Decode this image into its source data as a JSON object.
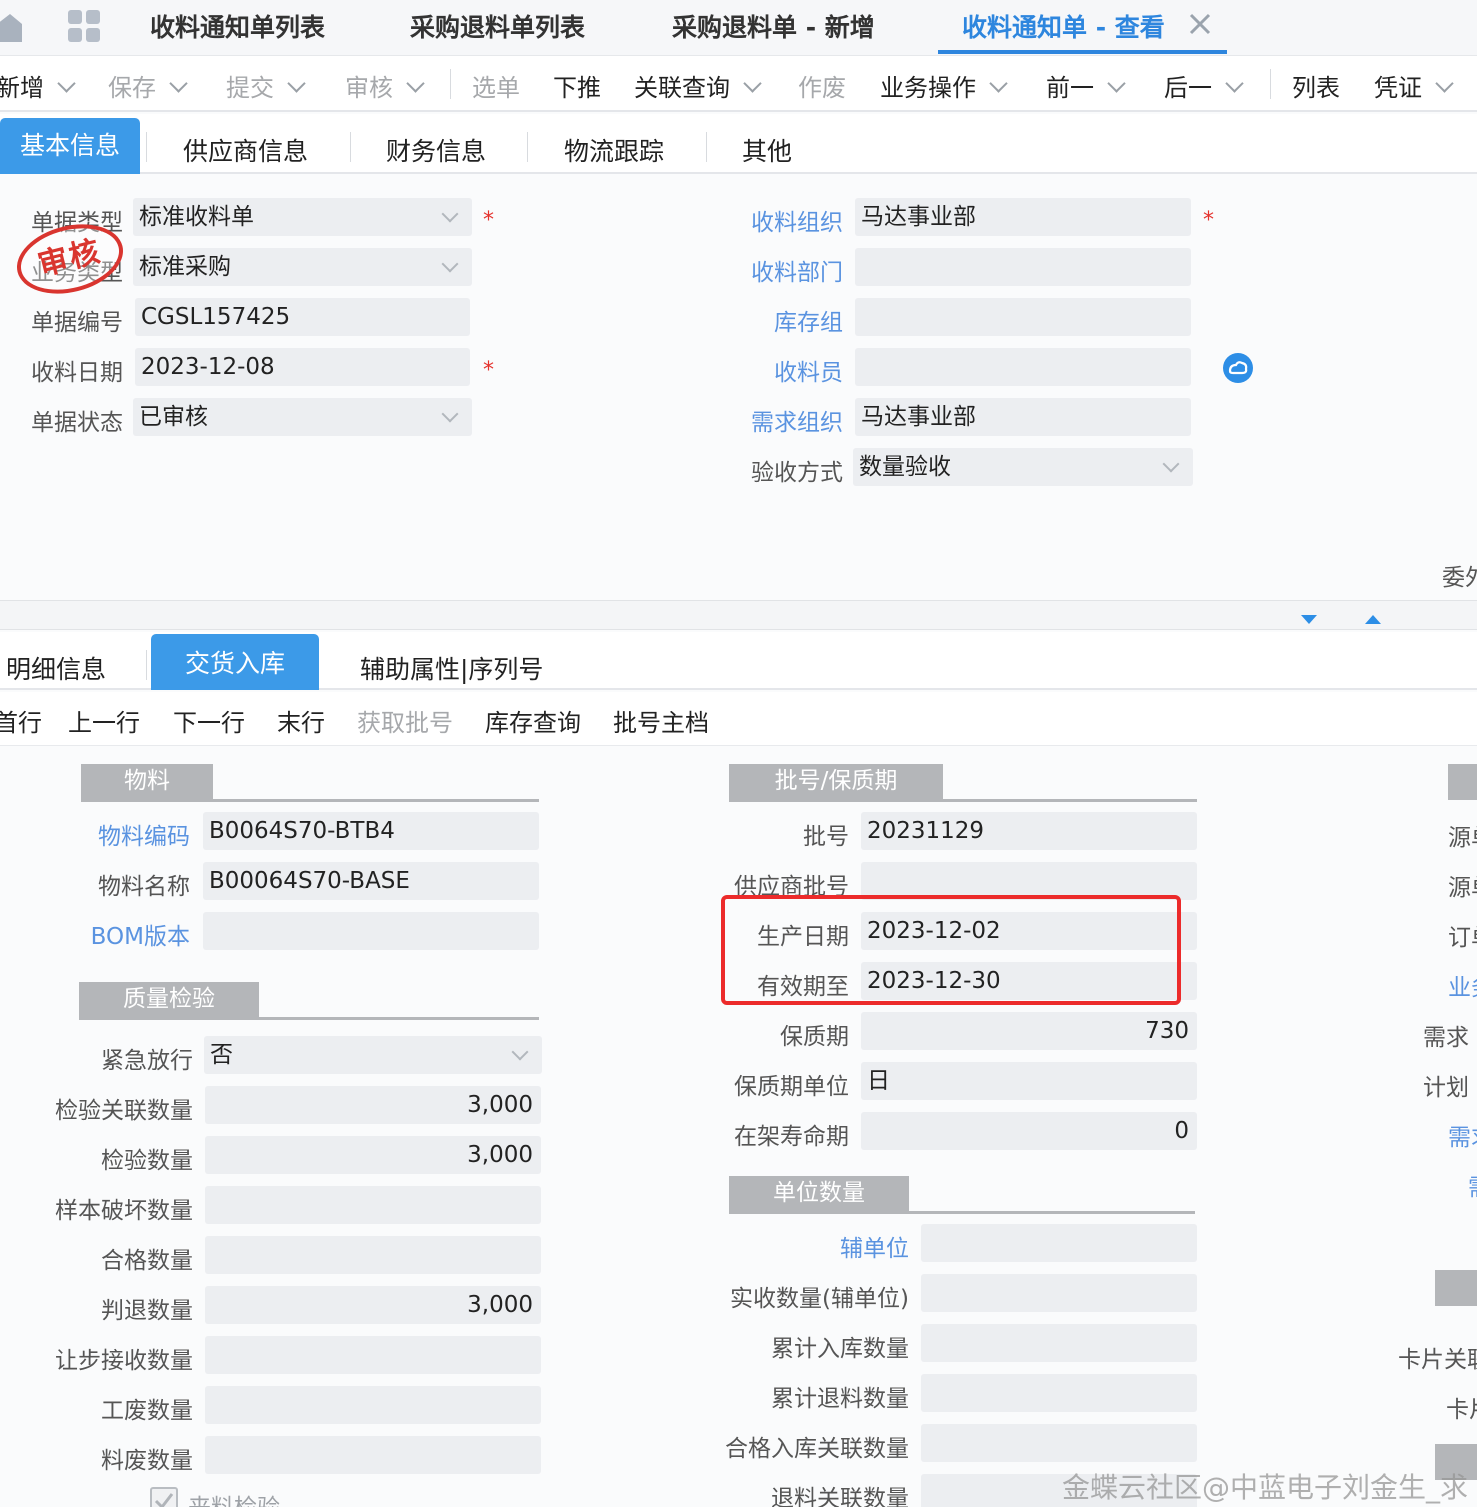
{
  "app_tabs": [
    {
      "label": "收料通知单列表"
    },
    {
      "label": "采购退料单列表"
    },
    {
      "label": "采购退料单 - 新增"
    },
    {
      "label": "收料通知单 - 查看"
    }
  ],
  "toolbar": {
    "new": "新增",
    "save": "保存",
    "submit": "提交",
    "audit": "审核",
    "select_bill": "选单",
    "push_down": "下推",
    "related_query": "关联查询",
    "void": "作废",
    "business_ops": "业务操作",
    "prev": "前一",
    "next": "后一",
    "list": "列表",
    "voucher": "凭证"
  },
  "header_tabs": [
    {
      "label": "基本信息"
    },
    {
      "label": "供应商信息"
    },
    {
      "label": "财务信息"
    },
    {
      "label": "物流跟踪"
    },
    {
      "label": "其他"
    }
  ],
  "stamp_text": "审核",
  "basic": {
    "bill_type_label": "单据类型",
    "bill_type": "标准收料单",
    "business_type_label": "业务类型",
    "business_type": "标准采购",
    "bill_no_label": "单据编号",
    "bill_no": "CGSL157425",
    "receive_date_label": "收料日期",
    "receive_date": "2023-12-08",
    "status_label": "单据状态",
    "status": "已审核",
    "recv_org_label": "收料组织",
    "recv_org": "马达事业部",
    "recv_dept_label": "收料部门",
    "recv_dept": "",
    "stock_group_label": "库存组",
    "stock_group": "",
    "receiver_label": "收料员",
    "receiver": "",
    "demand_org_label": "需求组织",
    "demand_org": "马达事业部",
    "accept_method_label": "验收方式",
    "accept_method": "数量验收",
    "cut_label": "委外"
  },
  "detail_tabs": [
    {
      "label": "明细信息"
    },
    {
      "label": "交货入库"
    },
    {
      "label": "辅助属性|序列号"
    }
  ],
  "row_toolbar": {
    "first": "首行",
    "prev": "上一行",
    "next": "下一行",
    "last": "末行",
    "get_lot": "获取批号",
    "stock_query": "库存查询",
    "lot_master": "批号主档"
  },
  "material": {
    "header": "物料",
    "code_label": "物料编码",
    "code": "B0064S70-BTB4",
    "name_label": "物料名称",
    "name": "B00064S70-BASE",
    "bom_label": "BOM版本",
    "bom": ""
  },
  "quality": {
    "header": "质量检验",
    "urgent_label": "紧急放行",
    "urgent": "否",
    "insp_link_qty_label": "检验关联数量",
    "insp_link_qty": "3,000",
    "insp_qty_label": "检验数量",
    "insp_qty": "3,000",
    "sample_damage_label": "样本破坏数量",
    "sample_damage": "",
    "qualified_label": "合格数量",
    "qualified": "",
    "rejected_label": "判退数量",
    "rejected": "3,000",
    "concession_label": "让步接收数量",
    "concession": "",
    "scrap_work_label": "工废数量",
    "scrap_work": "",
    "scrap_mat_label": "料废数量",
    "scrap_mat": "",
    "incoming_insp_label": "来料检验"
  },
  "lot": {
    "header": "批号/保质期",
    "lot_no_label": "批号",
    "lot_no": "20231129",
    "supplier_lot_label": "供应商批号",
    "supplier_lot": "",
    "prod_date_label": "生产日期",
    "prod_date": "2023-12-02",
    "expiry_label": "有效期至",
    "expiry": "2023-12-30",
    "shelf_life_label": "保质期",
    "shelf_life": "730",
    "shelf_unit_label": "保质期单位",
    "shelf_unit": "日",
    "shelf_on_label": "在架寿命期",
    "shelf_on": "0"
  },
  "unitqty": {
    "header": "单位数量",
    "aux_unit_label": "辅单位",
    "aux_unit": "",
    "actual_aux_label": "实收数量(辅单位)",
    "actual_aux": "",
    "cum_in_label": "累计入库数量",
    "cum_in": "",
    "cum_ret_label": "累计退料数量",
    "cum_ret": "",
    "qual_in_link_label": "合格入库关联数量",
    "qual_in_link": "",
    "ret_link_label": "退料关联数量",
    "ret_link": ""
  },
  "right_cut": [
    "源单",
    "源单",
    "订单",
    "业务",
    "需求",
    "计划",
    "需求",
    "需",
    "卡片关联",
    "卡片"
  ],
  "watermark": "金蝶云社区@中蓝电子刘金生_求"
}
